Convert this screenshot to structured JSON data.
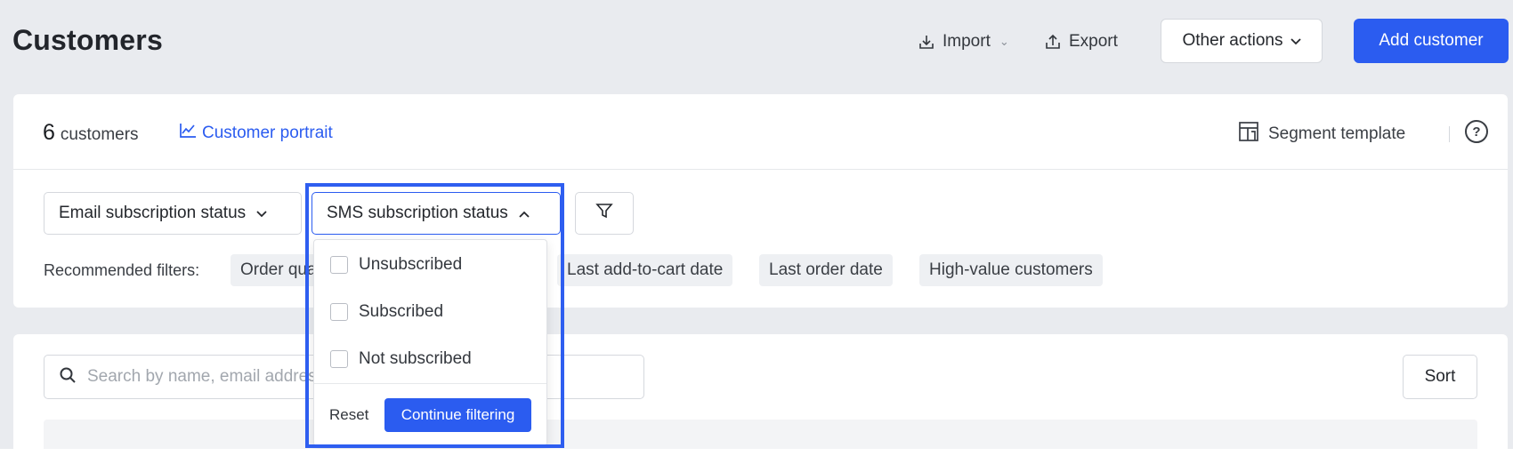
{
  "header": {
    "title": "Customers",
    "import_label": "Import",
    "export_label": "Export",
    "other_actions_label": "Other actions",
    "add_customer_label": "Add customer"
  },
  "summary": {
    "count": "6",
    "count_label": "customers",
    "portrait_link": "Customer portrait",
    "segment_template": "Segment template",
    "help": "?"
  },
  "filters": {
    "email_status": "Email subscription status",
    "sms_status": "SMS subscription status",
    "recommended_label": "Recommended filters:",
    "recommended": [
      "Order quantity",
      "Last add-to-cart date",
      "Last order date",
      "High-value customers"
    ]
  },
  "sms_dropdown": {
    "options": [
      "Unsubscribed",
      "Subscribed",
      "Not subscribed"
    ],
    "reset_label": "Reset",
    "continue_label": "Continue filtering"
  },
  "list": {
    "search_placeholder": "Search by name, email address, phone number, or tags",
    "sort_label": "Sort"
  },
  "colors": {
    "accent": "#2b5cf0",
    "page_bg": "#e9ebef",
    "highlight": "#2e5ef0"
  },
  "icons": [
    "import-icon",
    "export-icon",
    "chevron-down-icon",
    "chevron-up-icon",
    "line-chart-icon",
    "layout-template-icon",
    "help-icon",
    "funnel-icon",
    "search-icon",
    "checkbox-icon"
  ]
}
